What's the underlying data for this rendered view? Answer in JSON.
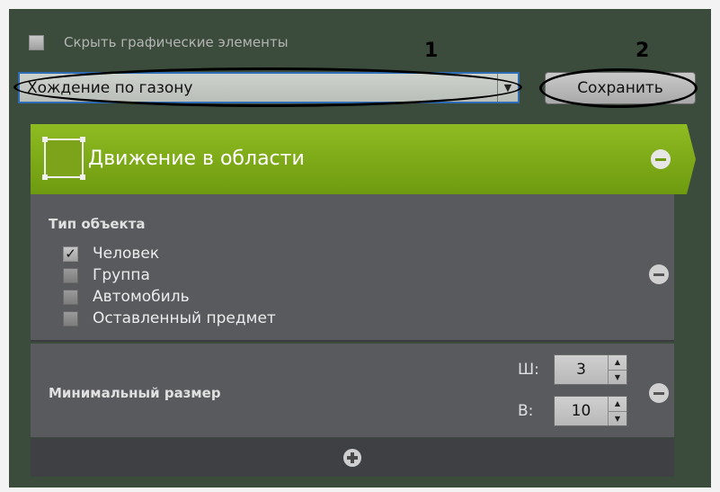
{
  "top": {
    "hide_graphics_label": "Скрыть графические элементы",
    "hide_graphics_checked": false
  },
  "callouts": {
    "one": "1",
    "two": "2"
  },
  "rule_select": {
    "value": "Хождение по газону"
  },
  "save_button": {
    "label": "Сохранить"
  },
  "header": {
    "title": "Движение в области",
    "accent": "#7ca31a"
  },
  "object_type": {
    "title": "Тип объекта",
    "options": [
      {
        "label": "Человек",
        "checked": true
      },
      {
        "label": "Группа",
        "checked": false
      },
      {
        "label": "Автомобиль",
        "checked": false
      },
      {
        "label": "Оставленный предмет",
        "checked": false
      }
    ]
  },
  "min_size": {
    "title": "Минимальный размер",
    "width_label": "Ш:",
    "width_value": "3",
    "height_label": "В:",
    "height_value": "10"
  },
  "icons": {
    "checkmark": "✓",
    "dropdown": "▼",
    "up": "▲",
    "down": "▼"
  }
}
